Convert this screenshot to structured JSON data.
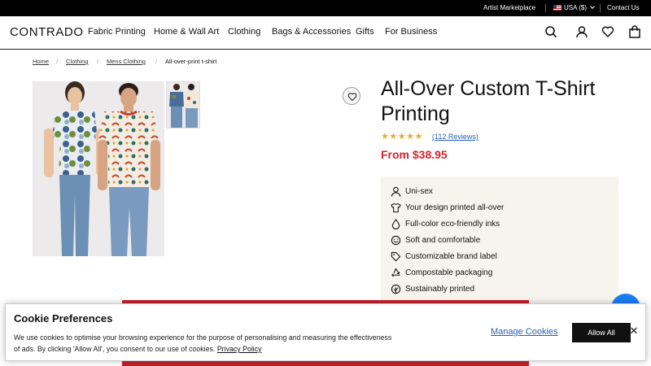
{
  "topbar": {
    "artist_marketplace": "Artist Marketplace",
    "region": "USA ($)",
    "contact": "Contact Us"
  },
  "header": {
    "logo": "CONTRADO",
    "nav": [
      "Fabric Printing",
      "Home & Wall Art",
      "Clothing",
      "Bags & Accessories",
      "Gifts",
      "For Business"
    ],
    "icons": [
      "search-icon",
      "account-icon",
      "heart-icon",
      "bag-icon"
    ]
  },
  "breadcrumb": [
    "Home",
    "Clothing",
    "Mens Clothing",
    "All-over-print t-shirt"
  ],
  "product": {
    "title": "All-Over Custom T-Shirt Printing",
    "rating": 5,
    "reviews": "(112 Reviews)",
    "price": "From $38.95",
    "features": [
      {
        "icon": "person-icon",
        "label": "Uni-sex"
      },
      {
        "icon": "tshirt-icon",
        "label": "Your design printed all-over"
      },
      {
        "icon": "drop-icon",
        "label": "Full-color eco-friendly inks"
      },
      {
        "icon": "smile-icon",
        "label": "Soft and comfortable"
      },
      {
        "icon": "tag-icon",
        "label": "Customizable brand label"
      },
      {
        "icon": "recycle-icon",
        "label": "Compostable packaging"
      },
      {
        "icon": "leaf-icon",
        "label": "Sustainably printed"
      }
    ]
  },
  "cookie": {
    "title": "Cookie Preferences",
    "text": "We use cookies to optimise your browsing experience for the purpose of personalising and measuring the effectiveness of ads. By clicking 'Allow All', you consent to our use of cookies.",
    "privacy_link": "Privacy Policy",
    "manage": "Manage Cookies",
    "allow": "Allow All",
    "close": "✕"
  },
  "colors": {
    "price": "#d9232d",
    "link": "#2a5fae",
    "star": "#f0a92a",
    "feature_bg": "#f7f4ee",
    "chat": "#1c7cf4",
    "promo_red": "#c3202e"
  }
}
